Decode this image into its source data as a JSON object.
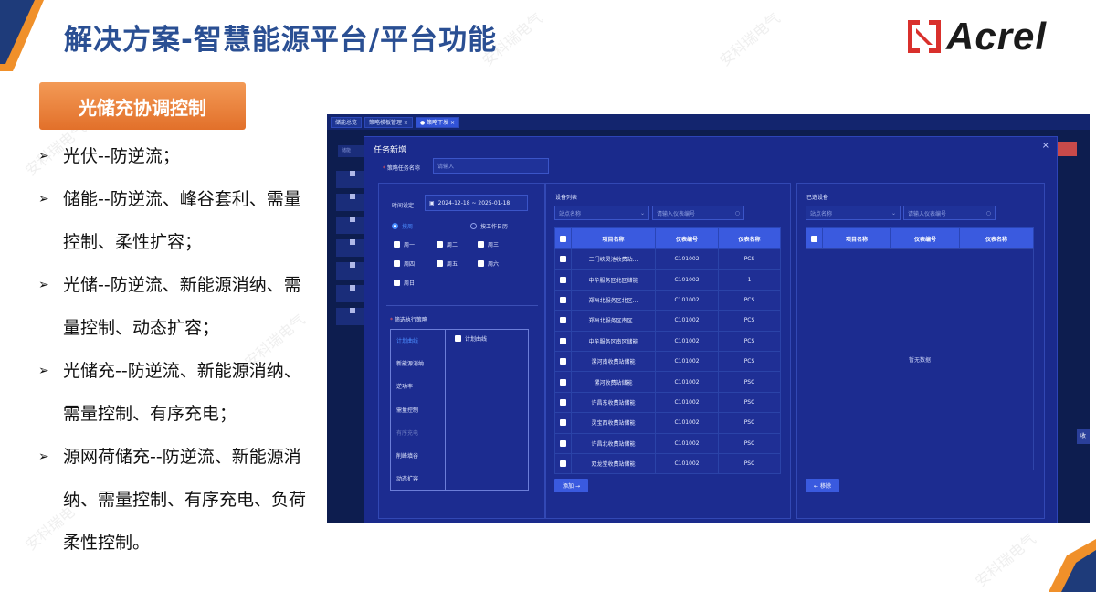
{
  "slide": {
    "title": "解决方案-智慧能源平台/平台功能",
    "logo_text": "Acrel",
    "section_badge": "光储充协调控制",
    "bullets": [
      {
        "text": "光伏--防逆流；"
      },
      {
        "text": "储能--防逆流、峰谷套利、需量控制、柔性扩容；"
      },
      {
        "text": "光储--防逆流、新能源消纳、需量控制、动态扩容；"
      },
      {
        "text": "光储充--防逆流、新能源消纳、需量控制、有序充电；"
      },
      {
        "text": "源网荷储充--防逆流、新能源消纳、需量控制、有序充电、负荷柔性控制。"
      }
    ],
    "watermark": "安科瑞电气",
    "colors": {
      "title": "#2a4f93",
      "badge": "#ef8a45",
      "logo_red": "#d9302c",
      "corner_orange": "#f0902a",
      "corner_blue": "#1e3b7a"
    }
  },
  "app": {
    "tabs": [
      {
        "label": "储能总览"
      },
      {
        "label": "策略模板管理 ×"
      },
      {
        "label": "● 策略下发 ×"
      }
    ],
    "bg_left_label": "储能",
    "bg_red_button": "",
    "bg_side_button": "收",
    "dialog": {
      "title": "任务新增",
      "close": "×",
      "task_name_label": "策略任务名称",
      "task_name_placeholder": "请输入",
      "time_label": "时间设定",
      "date_range": "2024-12-18  ~  2025-01-18",
      "radio_weekly": "按周",
      "radio_workday": "按工作日历",
      "weekdays": [
        "周一",
        "周二",
        "周三",
        "周四",
        "周五",
        "周六",
        "周日"
      ],
      "strategy_label": "筛选执行策略",
      "strategies": [
        "计划曲线",
        "新能源消纳",
        "逆功率",
        "需量控制",
        "有序充电",
        "削峰填谷",
        "动态扩容"
      ],
      "strategy_option": "计划曲线",
      "device_list": {
        "title": "设备列表",
        "station_placeholder": "站点名称",
        "meter_placeholder": "请输入仪表编号",
        "columns": [
          "项目名称",
          "仪表编号",
          "仪表名称"
        ],
        "rows": [
          [
            "三门峡灵池收费站...",
            "C101002",
            "PCS"
          ],
          [
            "中牟服务区北区储能",
            "C101002",
            "1"
          ],
          [
            "郑州北服务区北区...",
            "C101002",
            "PCS"
          ],
          [
            "郑州北服务区南区...",
            "C101002",
            "PCS"
          ],
          [
            "中牟服务区南区储能",
            "C101002",
            "PCS"
          ],
          [
            "漯河南收费站储能",
            "C101002",
            "PCS"
          ],
          [
            "漯河收费站储能",
            "C101002",
            "PSC"
          ],
          [
            "许昌东收费站储能",
            "C101002",
            "PSC"
          ],
          [
            "灵宝西收费站储能",
            "C101002",
            "PSC"
          ],
          [
            "许昌北收费站储能",
            "C101002",
            "PSC"
          ],
          [
            "双龙堂收费站储能",
            "C101002",
            "PSC"
          ]
        ],
        "add_button": "添加 →"
      },
      "selected": {
        "title": "已选设备",
        "station_placeholder": "站点名称",
        "meter_placeholder": "请输入仪表编号",
        "columns": [
          "项目名称",
          "仪表编号",
          "仪表名称"
        ],
        "empty_text": "暂无数据",
        "remove_button": "← 移除"
      }
    }
  }
}
